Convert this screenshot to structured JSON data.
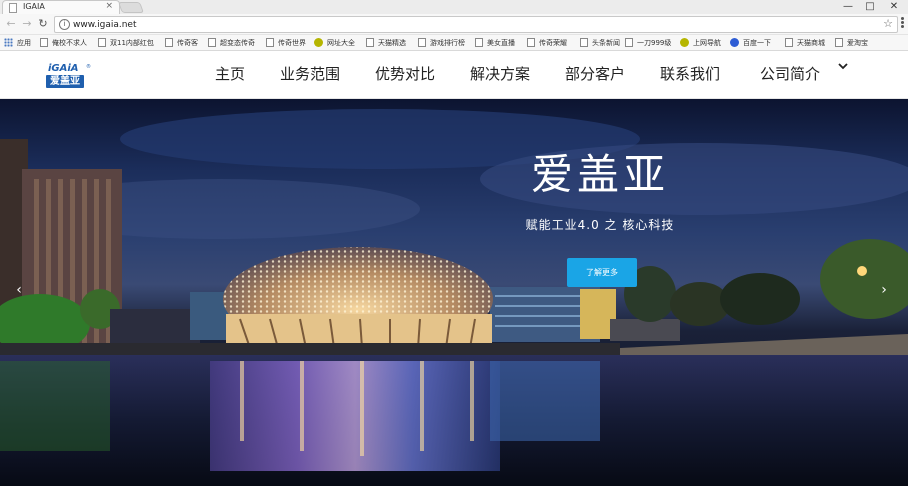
{
  "browser": {
    "tab_title": "IGAIA",
    "tab_close": "×",
    "url": "www.igaia.net",
    "controls": {
      "minimize": "—",
      "maximize": "□",
      "close": "✕"
    }
  },
  "bookmarks": [
    {
      "label": "应用",
      "icon": "apps-icon"
    },
    {
      "label": "俺校不求人",
      "icon": "page-icon"
    },
    {
      "label": "双11内部红包",
      "icon": "page-icon"
    },
    {
      "label": "传奇客",
      "icon": "page-icon"
    },
    {
      "label": "超变态传奇",
      "icon": "page-icon"
    },
    {
      "label": "传奇世界",
      "icon": "page-icon"
    },
    {
      "label": "网址大全",
      "icon": "ie-icon"
    },
    {
      "label": "天猫精选",
      "icon": "page-icon"
    },
    {
      "label": "游戏排行榜",
      "icon": "page-icon"
    },
    {
      "label": "美女直播",
      "icon": "page-icon"
    },
    {
      "label": "传奇荣耀",
      "icon": "page-icon"
    },
    {
      "label": "头条新闻",
      "icon": "page-icon"
    },
    {
      "label": "一刀999级",
      "icon": "page-icon"
    },
    {
      "label": "上网导航",
      "icon": "ie-icon"
    },
    {
      "label": "百度一下",
      "icon": "baidu-icon"
    },
    {
      "label": "天猫商城",
      "icon": "page-icon"
    },
    {
      "label": "爱淘宝",
      "icon": "page-icon"
    }
  ],
  "site": {
    "logo_top": "iGAiA",
    "logo_reg": "®",
    "logo_bottom": "爱盖亚",
    "nav": [
      "主页",
      "业务范围",
      "优势对比",
      "解决方案",
      "部分客户",
      "联系我们",
      "公司简介"
    ]
  },
  "hero": {
    "title": "爱盖亚",
    "subtitle": "赋能工业4.0 之 核心科技",
    "button": "了解更多",
    "prev": "‹",
    "next": "›",
    "slide_count": 3,
    "active_slide": 1
  },
  "colors": {
    "brand": "#1f5fae",
    "button": "#1aa5e6"
  }
}
